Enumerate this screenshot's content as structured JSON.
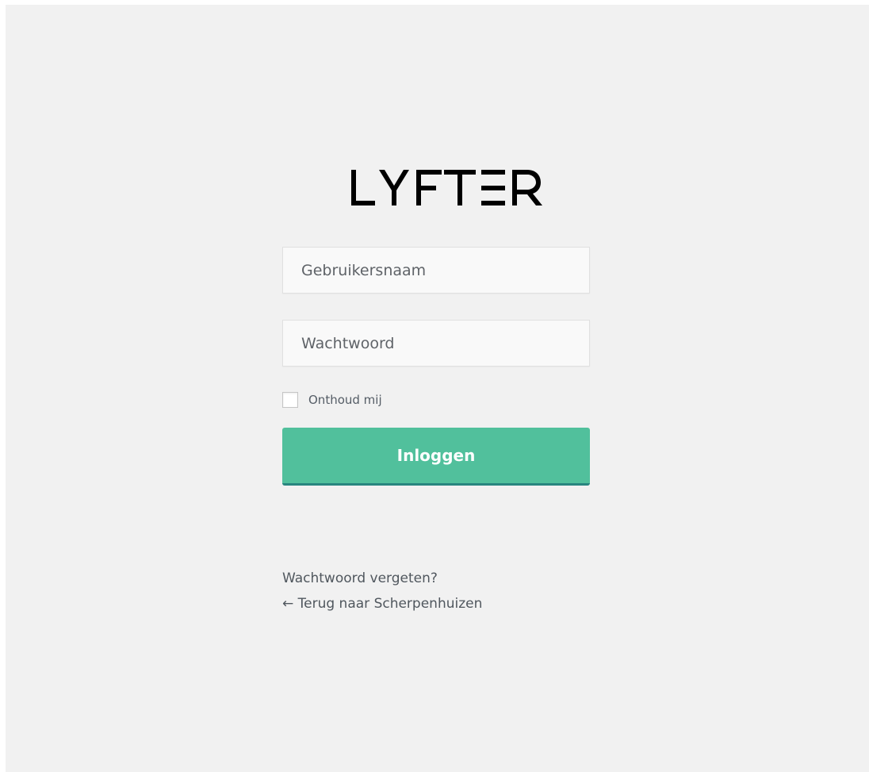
{
  "brand": {
    "logo_text": "LYFTER",
    "color": "#000000"
  },
  "form": {
    "username_placeholder": "Gebruikersnaam",
    "username_value": "",
    "password_placeholder": "Wachtwoord",
    "password_value": "",
    "remember_label": "Onthoud mij",
    "remember_checked": false,
    "submit_label": "Inloggen"
  },
  "links": {
    "lost_password": "Wachtwoord vergeten?",
    "back_to_site": "← Terug naar Scherpenhuizen"
  },
  "colors": {
    "background": "#f1f1f1",
    "accent": "#51c09c",
    "accent_border": "#29857f",
    "text": "#50575e"
  },
  "icons": {
    "checkbox": "checkbox-empty-icon"
  }
}
